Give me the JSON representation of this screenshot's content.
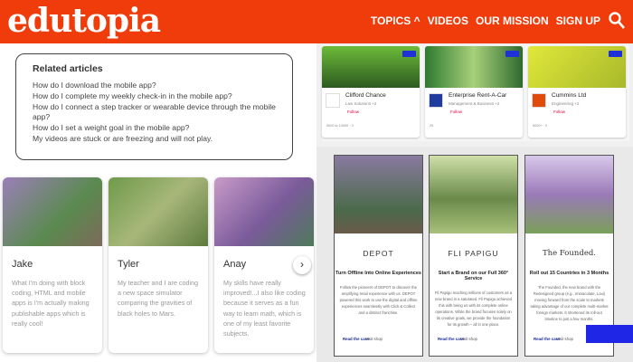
{
  "header": {
    "logo": "edutopia",
    "nav": [
      "TOPICS ^",
      "VIDEOS",
      "OUR MISSION",
      "SIGN UP"
    ]
  },
  "related": {
    "title": "Related articles",
    "links": [
      "How do I download the mobile app?",
      "How do I complete my weekly check-in in the mobile app?",
      "How do I connect a step tracker or wearable device through the mobile app?",
      "How do I set a weight goal in the mobile app?",
      "My videos are stuck or are freezing and will not play."
    ]
  },
  "testimonials": [
    {
      "name": "Jake",
      "text": "What I'm doing with block coding, HTML and mobile apps is I'm actually making publishable apps which is really cool!"
    },
    {
      "name": "Tyler",
      "text": "My teacher and I are coding a new space simulator comparing the gravities of black holes to Mars."
    },
    {
      "name": "Anay",
      "text": "My skills have really improved!...I also like coding because it serves as a fun way to learn math, which is one of my least favorite subjects."
    }
  ],
  "profiles": [
    {
      "company": "Clifford Chance",
      "industry": "Law Solutions +2",
      "follow": "Follow",
      "stats": "5000 to 10000 · 0",
      "img": "#3a7a2a"
    },
    {
      "company": "Enterprise Rent-A-Car",
      "industry": "Management & Business +2",
      "follow": "Follow",
      "stats": "25",
      "img": "#2a6b2b"
    },
    {
      "company": "Cummins Ltd",
      "industry": "Engineering +2",
      "follow": "Follow",
      "stats": "5000+ · 0",
      "img": "#c8d61a"
    }
  ],
  "cases": [
    {
      "brand": "DEPOT",
      "heading": "Turn Offline Into Online Experiences",
      "desc": "Follow the pioneers of DEPOT to discover the amplifying retail experience with us. DEPOT powered this work to use the digital and offline experiences seamlessly with Click & Collect and a distinct franchise.",
      "read": "Read the case",
      "visit": "Visit shop"
    },
    {
      "brand": "FLI PAPIGU",
      "heading": "Start a Brand on our Full 360° Service",
      "desc": "Fli Papigu reaching millions of customers as a new brand in a saturated. Fli Papigu achieved this with being us with its complete online operations. While the brand focuses solely on its creative goals, we provide the foundation for its growth – all in one place.",
      "read": "Read the case",
      "visit": "Visit shop"
    },
    {
      "brand": "The Founded.",
      "heading": "Roll out 15 Countries in 3 Months",
      "desc": "The Founded, the new brand with the Redesigned group (e.g., Immaculate, Loui) moving forward from the scale to markets taking advantage of our complete multi-market foreign markets. It shortened its roll-out timeline to just a few months.",
      "read": "Read the case",
      "visit": "Visit shop"
    }
  ],
  "colors": {
    "brand": "#f03c0a",
    "accent": "#2026e6"
  }
}
